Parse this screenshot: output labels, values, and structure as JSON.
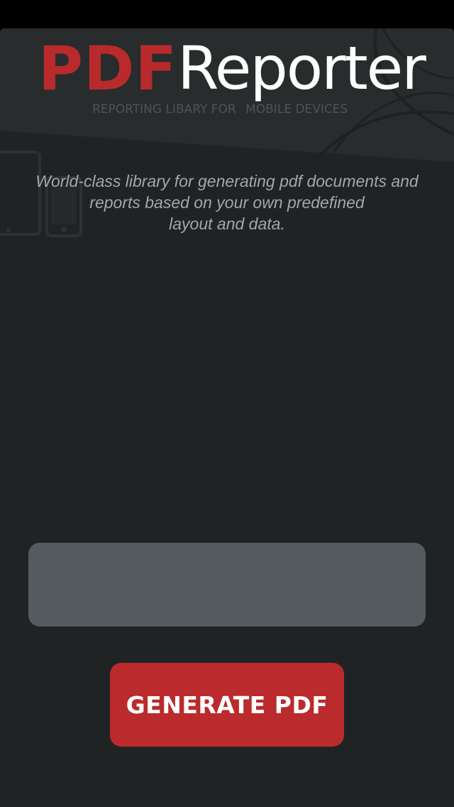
{
  "app": {
    "logo_pdf": "PDF",
    "logo_reporter": "Reporter",
    "tagline_left": "REPORTING LIBARY FOR",
    "tagline_right": "MOBILE DEVICES",
    "description": "World-class library for generating pdf documents and\nreports based on your own predefined\nlayout and data."
  },
  "form": {
    "input_value": "",
    "generate_label": "GENERATE PDF"
  },
  "colors": {
    "background": "#202324",
    "brand_red": "#bb2a2c",
    "input_gray": "#545b5f",
    "description_text": "#a3a7a9"
  },
  "icons": {
    "devices": "tablet-and-phone-icon"
  }
}
